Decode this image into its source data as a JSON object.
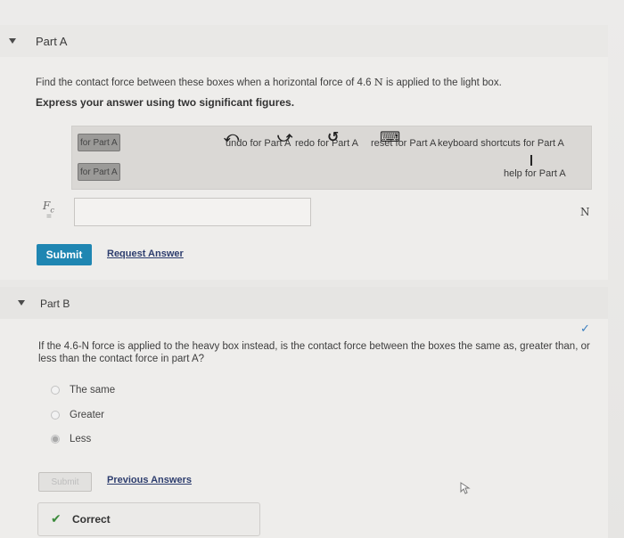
{
  "partA": {
    "header": "Part A",
    "question_prefix": "Find the contact force between these boxes when a horizontal force of 4.6 ",
    "question_unit": "N",
    "question_suffix": " is applied to the light box.",
    "instruction": "Express your answer using two significant figures.",
    "toolbar": {
      "btn1": "for Part A",
      "btn2": "for Part A",
      "undo": "undo for Part A",
      "redo": "redo for Part A",
      "reset": "reset for Part A",
      "keyboard": "keyboard shortcuts for Part A",
      "help": "help for Part A"
    },
    "variable": "F",
    "variable_sub": "c",
    "equals": "=",
    "answer_value": "",
    "unit": "N",
    "submit": "Submit",
    "request_answer": "Request Answer"
  },
  "partB": {
    "header": "Part B",
    "question": "If the 4.6-N force is applied to the heavy box instead, is the contact force between the boxes the same as, greater than, or less than the contact force in part A?",
    "options": [
      "The same",
      "Greater",
      "Less"
    ],
    "selected_index": 2,
    "submit": "Submit",
    "previous_answers": "Previous Answers",
    "result": "Correct",
    "result_color": "#3c8b3c"
  },
  "colors": {
    "accent": "#1f86b2",
    "link": "#2d3d6e",
    "check": "#3c7fbf"
  }
}
